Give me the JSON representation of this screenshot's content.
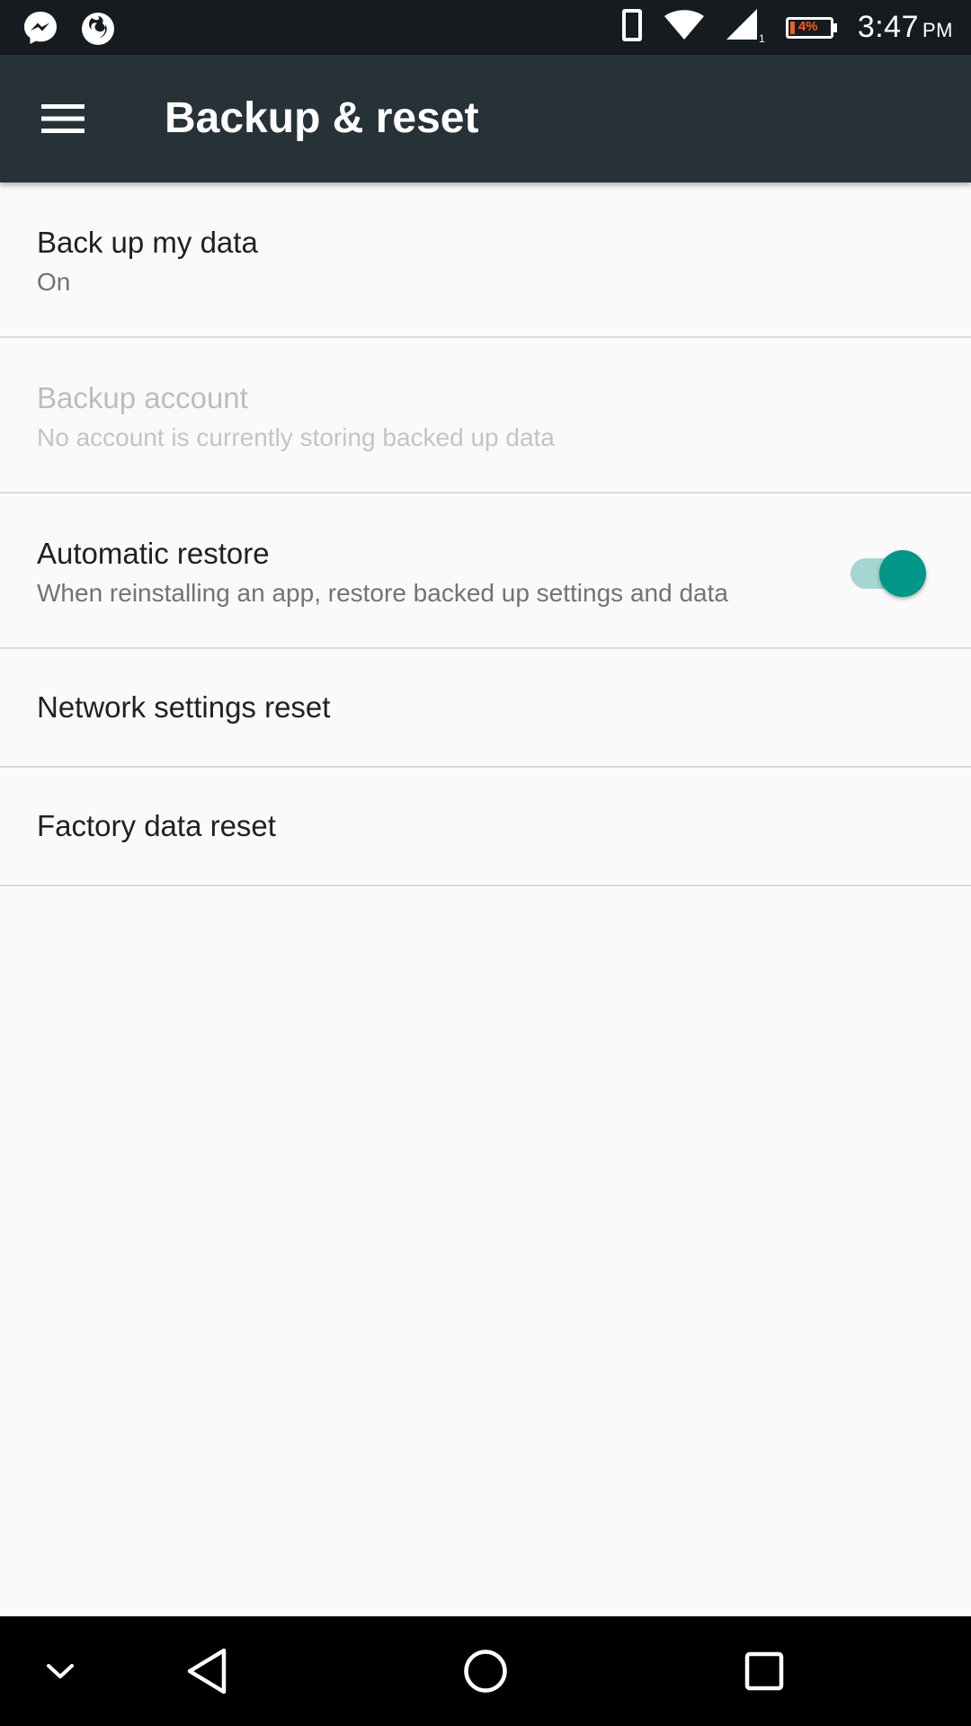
{
  "status_bar": {
    "time": "3:47",
    "ampm": "PM",
    "battery_percent": "4%",
    "notification_icons": [
      "messenger-icon",
      "firefox-icon"
    ],
    "system_icons": [
      "device-icon",
      "wifi-icon",
      "cellular-signal-icon",
      "battery-icon"
    ]
  },
  "toolbar": {
    "title": "Backup & reset",
    "menu_icon": "hamburger-menu-icon"
  },
  "settings": {
    "backup_my_data": {
      "title": "Back up my data",
      "summary": "On"
    },
    "backup_account": {
      "title": "Backup account",
      "summary": "No account is currently storing backed up data",
      "enabled": false
    },
    "automatic_restore": {
      "title": "Automatic restore",
      "summary": "When reinstalling an app, restore backed up settings and data",
      "checked": true
    },
    "network_settings_reset": {
      "title": "Network settings reset"
    },
    "factory_data_reset": {
      "title": "Factory data reset"
    }
  },
  "colors": {
    "status_bar": "#161b1f",
    "toolbar": "#263238",
    "accent": "#009688",
    "background": "#fafafa",
    "battery_low": "#ff5722"
  },
  "nav_bar": {
    "icons": [
      "chevron-down-icon",
      "back-icon",
      "home-icon",
      "recents-icon"
    ]
  }
}
